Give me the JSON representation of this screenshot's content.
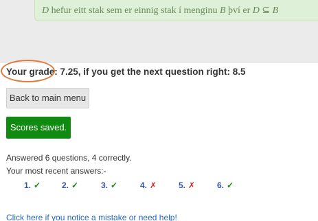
{
  "question": {
    "feedback_prefix": "D",
    "feedback_mid": " hefur eitt stak sem er einnig stak í menginu ",
    "feedback_set": "B",
    "feedback_tail": " því er ",
    "feedback_sub_a": "D",
    "feedback_subset_symbol": " ⊆ ",
    "feedback_sub_b": "B"
  },
  "grade": {
    "text": "Your grade: 7.25, if you get the next question right: 8.5"
  },
  "buttons": {
    "back_label": "Back to main menu"
  },
  "status": {
    "saved_label": "Scores saved."
  },
  "summary": {
    "answered_text": "Answered 6 questions, 4 correctly.",
    "recent_label": "Your most recent answers:-"
  },
  "answers": [
    {
      "number": "1.",
      "mark": "✓",
      "correct": true
    },
    {
      "number": "2.",
      "mark": "✓",
      "correct": true
    },
    {
      "number": "3.",
      "mark": "✓",
      "correct": true
    },
    {
      "number": "4.",
      "mark": "✗",
      "correct": false
    },
    {
      "number": "5.",
      "mark": "✗",
      "correct": false
    },
    {
      "number": "6.",
      "mark": "✓",
      "correct": true
    }
  ],
  "links": {
    "help_text": "Click here if you notice a mistake or need help!"
  },
  "colors": {
    "saved_bg": "#118a11",
    "correct": "#118a11",
    "incorrect": "#dd2222",
    "link": "#1f66c0",
    "highlight_circle": "#e07a3c"
  }
}
